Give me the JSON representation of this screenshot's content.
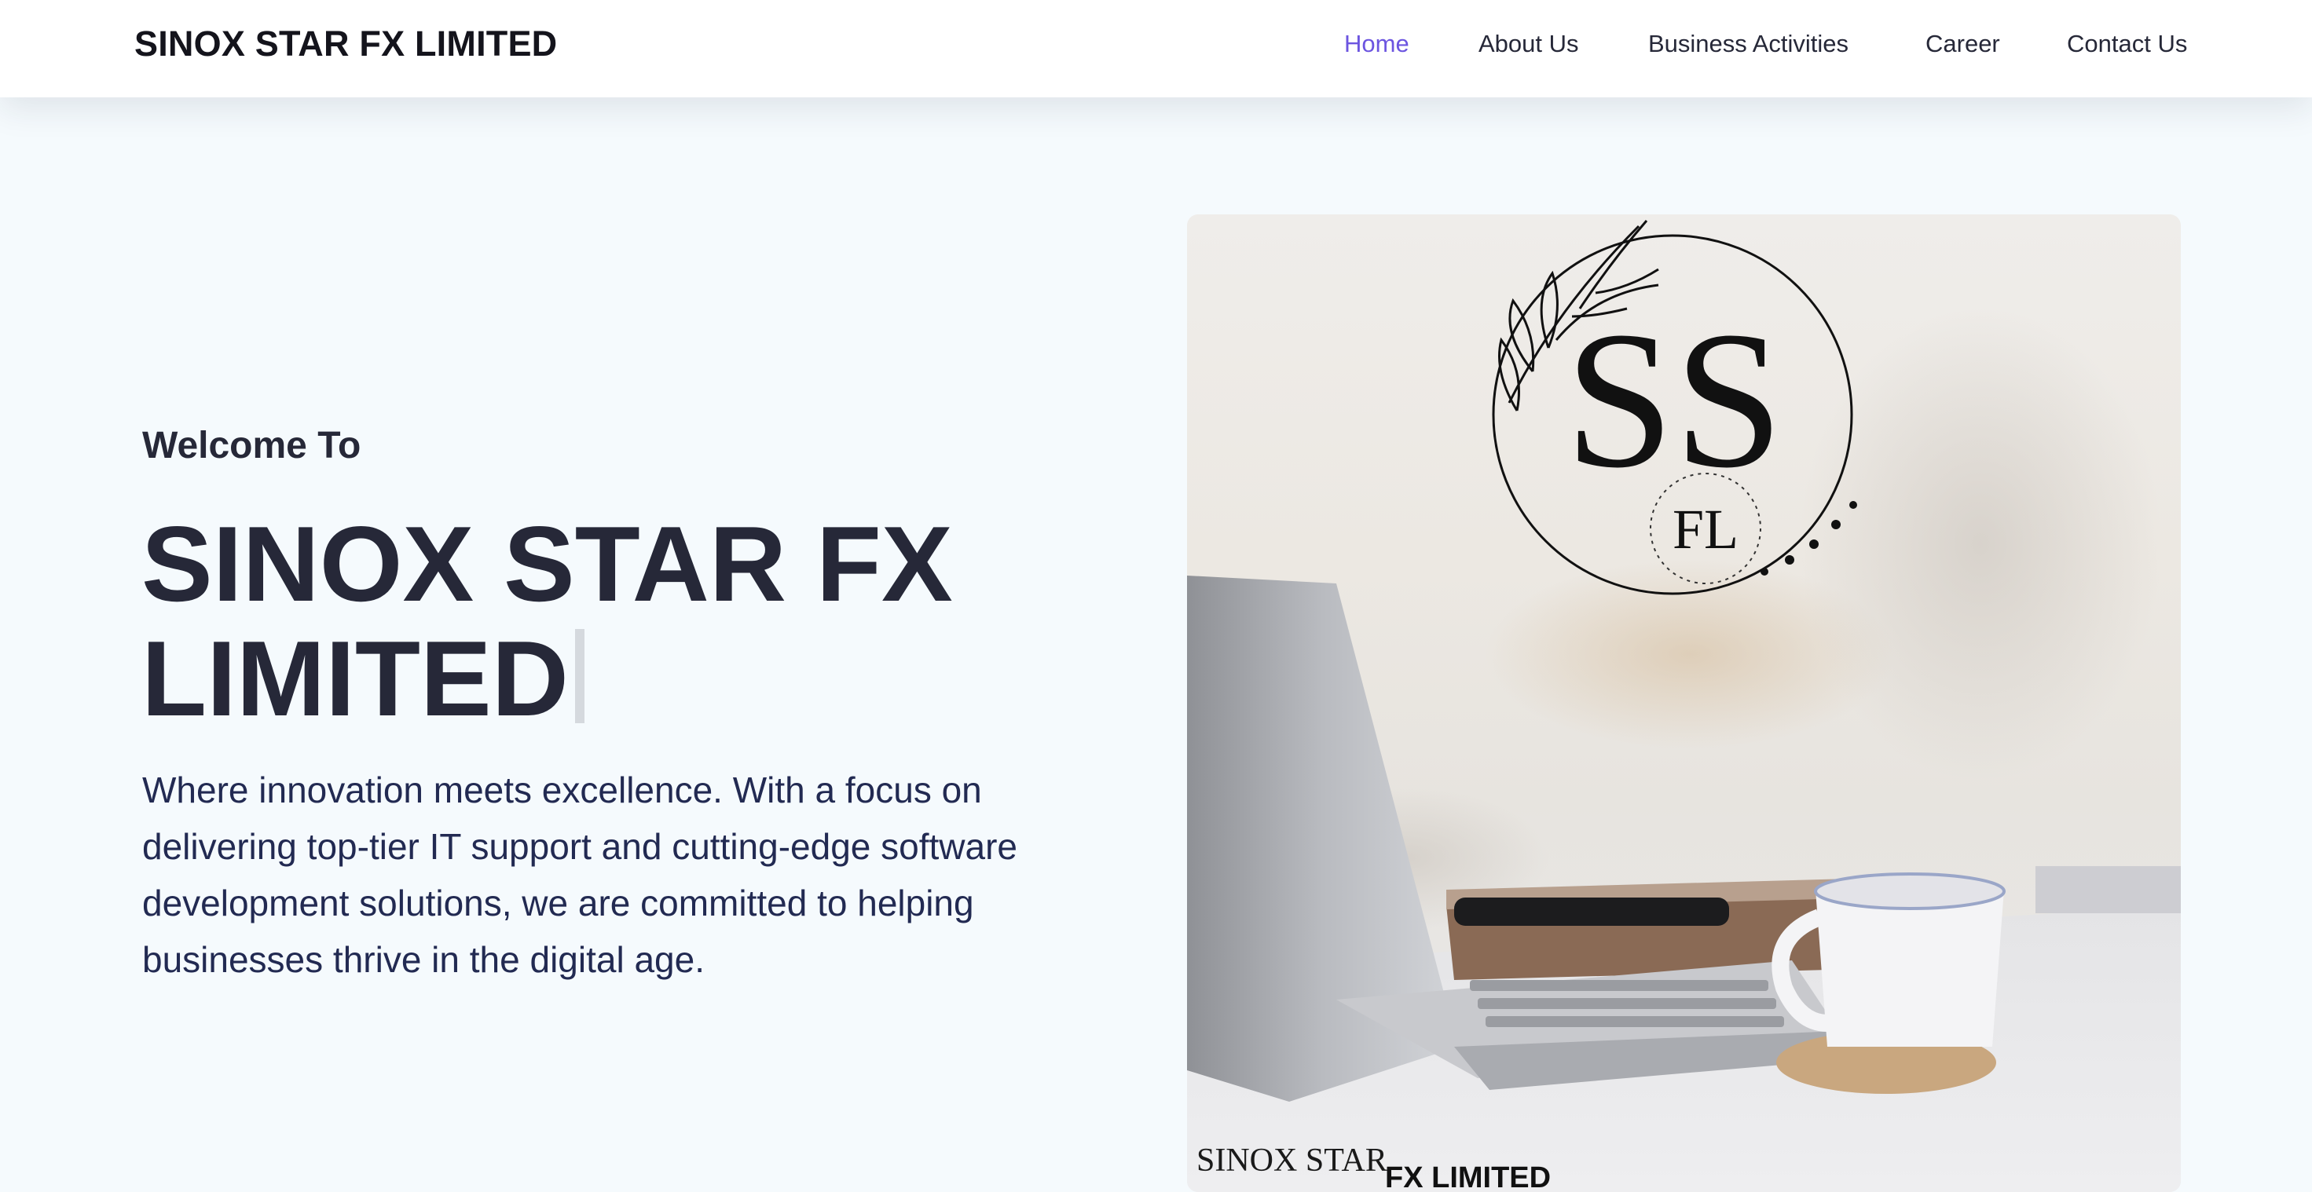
{
  "header": {
    "brand": "SINOX STAR FX LIMITED",
    "nav": [
      {
        "label": "Home",
        "active": true
      },
      {
        "label": "About Us",
        "active": false
      },
      {
        "label": "Business Activities",
        "active": false
      },
      {
        "label": "Career",
        "active": false
      },
      {
        "label": "Contact Us",
        "active": false
      }
    ]
  },
  "hero": {
    "welcome": "Welcome To",
    "title": "SINOX STAR FX LIMITED",
    "description": "Where innovation meets excellence. With a focus on delivering top-tier IT support and cutting-edge software development solutions, we are committed to helping businesses thrive in the digital age.",
    "image": {
      "logo_letters": "SS",
      "logo_inner": "FL",
      "caption_line1": "SINOX STAR",
      "caption_line2": "FX LIMITED"
    }
  },
  "colors": {
    "accent": "#6c55e0",
    "text_dark": "#262838",
    "background": "#f5fafd"
  }
}
